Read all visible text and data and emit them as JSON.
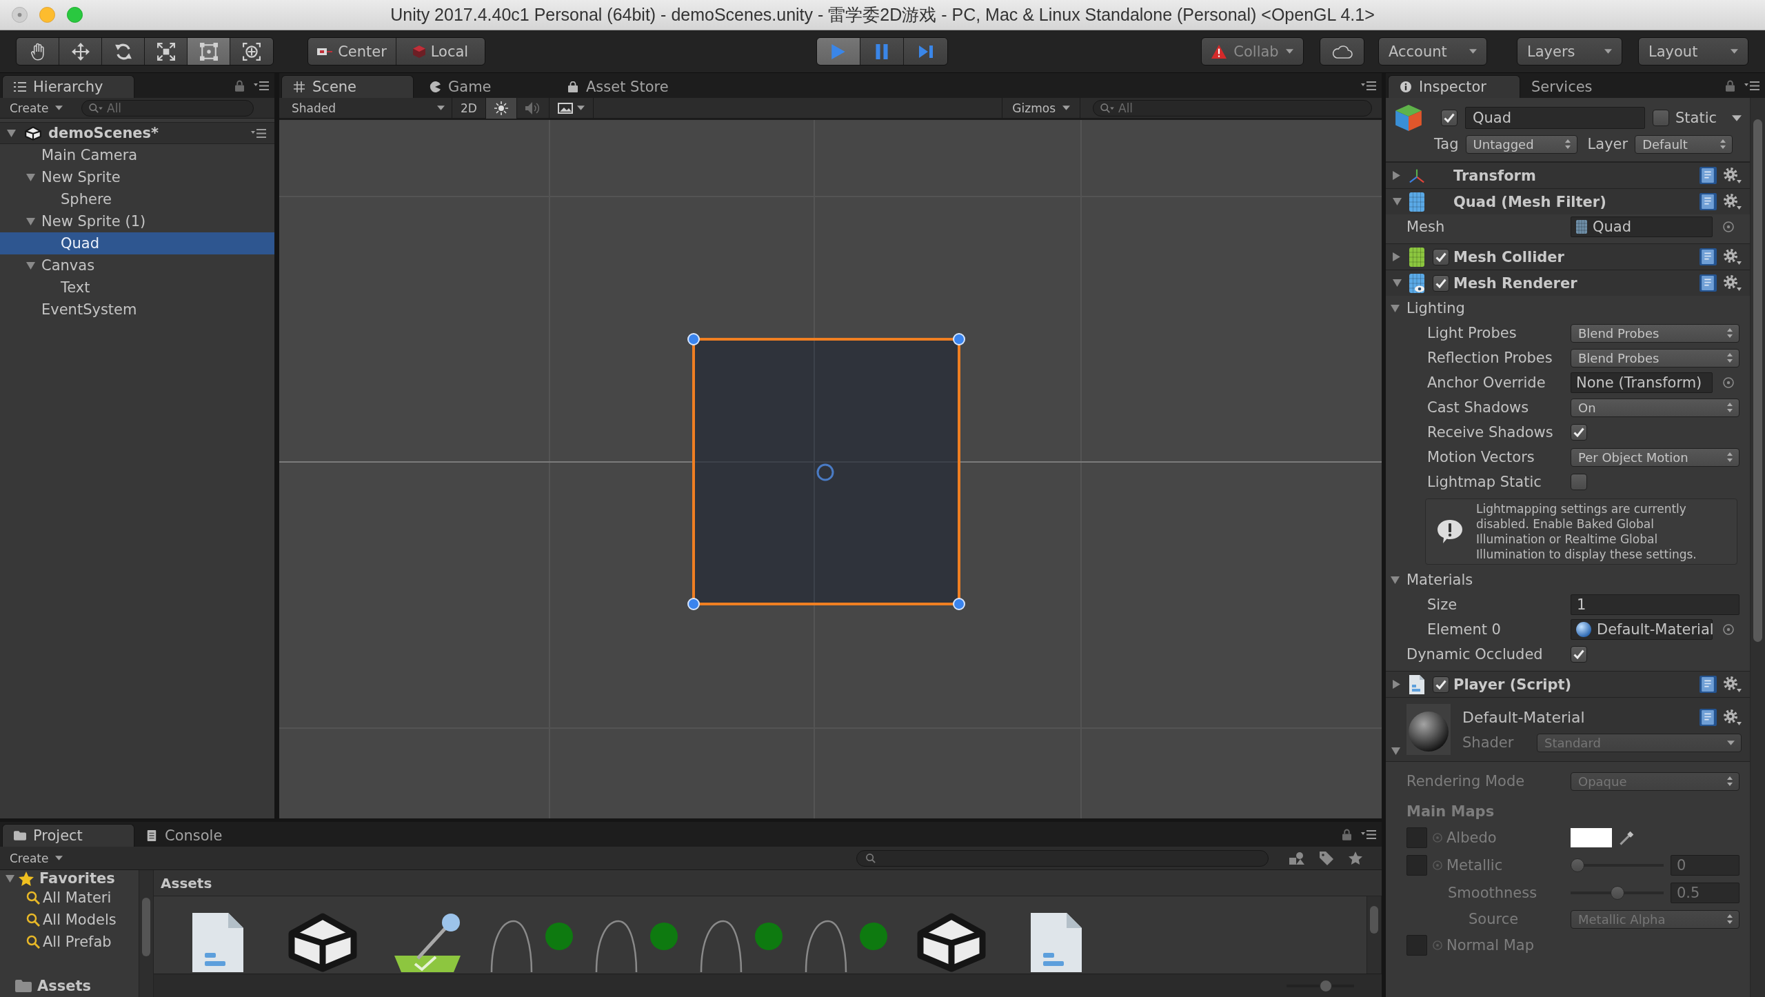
{
  "window": {
    "title": "Unity 2017.4.40c1 Personal (64bit) - demoScenes.unity - 雷学委2D游戏 - PC, Mac & Linux Standalone (Personal) <OpenGL 4.1>"
  },
  "toolbar": {
    "tools": [
      {
        "kind": "hand",
        "selected": false
      },
      {
        "kind": "move",
        "selected": false
      },
      {
        "kind": "rotate",
        "selected": false
      },
      {
        "kind": "scale",
        "selected": false
      },
      {
        "kind": "rect",
        "selected": true
      },
      {
        "kind": "transform",
        "selected": false
      }
    ],
    "pivot": [
      {
        "kind": "pivot",
        "label": "Center"
      },
      {
        "kind": "rotation",
        "label": "Local"
      }
    ],
    "playback": [
      {
        "kind": "play",
        "selected": true
      },
      {
        "kind": "pause",
        "selected": false
      },
      {
        "kind": "step",
        "selected": false
      }
    ],
    "collab": "Collab",
    "account": "Account",
    "layers": "Layers",
    "layout": "Layout"
  },
  "hierarchy": {
    "tab": "Hierarchy",
    "create": "Create",
    "search": {
      "placeholder": "All"
    },
    "root": {
      "name": "demoScenes*",
      "expanded": true,
      "children": [
        {
          "name": "Main Camera",
          "selected": false
        },
        {
          "name": "New Sprite",
          "selected": false,
          "expanded": true,
          "children": [
            {
              "name": "Sphere",
              "selected": false
            }
          ]
        },
        {
          "name": "New Sprite (1)",
          "selected": false,
          "expanded": true,
          "children": [
            {
              "name": "Quad",
              "selected": true
            }
          ]
        },
        {
          "name": "Canvas",
          "selected": false,
          "expanded": true,
          "children": [
            {
              "name": "Text",
              "selected": false
            }
          ]
        },
        {
          "name": "EventSystem",
          "selected": false
        }
      ]
    }
  },
  "scene": {
    "tabs": [
      {
        "kind": "scene",
        "label": "Scene",
        "selected": true
      },
      {
        "kind": "game",
        "label": "Game",
        "selected": false
      },
      {
        "kind": "store",
        "label": "Asset Store",
        "selected": false
      }
    ],
    "shading": "Shaded",
    "mode": "2D",
    "toggles": [
      {
        "kind": "lighting",
        "on": true
      },
      {
        "kind": "audio",
        "on": false
      }
    ],
    "gizmos": "Gizmos",
    "search": {
      "placeholder": "All"
    }
  },
  "inspector": {
    "tabs": [
      {
        "kind": "inspector",
        "label": "Inspector",
        "selected": true
      },
      {
        "kind": "services",
        "label": "Services",
        "selected": false
      }
    ],
    "object": {
      "active": true,
      "name": "Quad",
      "static": false,
      "static_label": "Static",
      "tag_label": "Tag",
      "tag": "Untagged",
      "layer_label": "Layer",
      "layer": "Default"
    },
    "components": [
      {
        "kind": "transform",
        "title": "Transform",
        "expanded": false
      },
      {
        "kind": "mesh_filter",
        "title": "Quad (Mesh Filter)",
        "expanded": true,
        "rows": [
          {
            "kind": "mesh_field",
            "label": "Mesh",
            "value": "Quad"
          }
        ]
      },
      {
        "kind": "mesh_collider",
        "title": "Mesh Collider",
        "expanded": false,
        "enabled": true
      },
      {
        "kind": "mesh_renderer",
        "title": "Mesh Renderer",
        "expanded": true,
        "enabled": true,
        "rows": [
          {
            "kind": "section",
            "label": "Lighting",
            "expanded": true,
            "children": [
              {
                "kind": "dropdown",
                "label": "Light Probes",
                "value": "Blend Probes"
              },
              {
                "kind": "dropdown",
                "label": "Reflection Probes",
                "value": "Blend Probes"
              },
              {
                "kind": "object_field",
                "label": "Anchor Override",
                "value": "None (Transform)"
              },
              {
                "kind": "dropdown",
                "label": "Cast Shadows",
                "value": "On"
              },
              {
                "kind": "checkbox",
                "label": "Receive Shadows",
                "checked": true
              },
              {
                "kind": "dropdown",
                "label": "Motion Vectors",
                "value": "Per Object Motion"
              },
              {
                "kind": "checkbox",
                "label": "Lightmap Static",
                "checked": false
              },
              {
                "kind": "help",
                "text": "Lightmapping settings are currently disabled. Enable Baked Global Illumination or Realtime Global Illumination to display these settings."
              }
            ]
          },
          {
            "kind": "section",
            "label": "Materials",
            "expanded": true,
            "children": [
              {
                "kind": "number",
                "label": "Size",
                "value": "1"
              },
              {
                "kind": "material_field",
                "label": "Element 0",
                "value": "Default-Material"
              }
            ]
          },
          {
            "kind": "checkbox",
            "label": "Dynamic Occluded",
            "checked": true
          }
        ]
      },
      {
        "kind": "script",
        "title": "Player (Script)",
        "expanded": false,
        "enabled": true
      },
      {
        "kind": "material",
        "title": "Default-Material",
        "expanded": true,
        "disabled": true,
        "shader_label": "Shader",
        "shader": "Standard",
        "rows": [
          {
            "kind": "dropdown",
            "label": "Rendering Mode",
            "value": "Opaque"
          },
          {
            "kind": "heading",
            "label": "Main Maps"
          },
          {
            "kind": "color_map",
            "label": "Albedo",
            "color": "#ffffff"
          },
          {
            "kind": "slider_map",
            "label": "Metallic",
            "level": 0,
            "reading": "0",
            "children": [
              {
                "kind": "slider",
                "label": "Smoothness",
                "level": 0.5,
                "reading": "0.5",
                "children": [
                  {
                    "kind": "dropdown",
                    "label": "Source",
                    "value": "Metallic Alpha"
                  }
                ]
              }
            ]
          },
          {
            "kind": "texture_map",
            "label": "Normal Map"
          }
        ]
      }
    ]
  },
  "project": {
    "tabs": [
      {
        "kind": "project",
        "label": "Project",
        "selected": true
      },
      {
        "kind": "console",
        "label": "Console",
        "selected": false
      }
    ],
    "create": "Create",
    "favorites": {
      "label": "Favorites",
      "expanded": true,
      "items": [
        "All Materi",
        "All Models",
        "All Prefab"
      ]
    },
    "root_folder": "Assets",
    "path": "Assets",
    "assets": [
      {
        "kind": "script"
      },
      {
        "kind": "scene"
      },
      {
        "kind": "controller"
      },
      {
        "kind": "clip"
      },
      {
        "kind": "clip"
      },
      {
        "kind": "clip"
      },
      {
        "kind": "clip"
      },
      {
        "kind": "scene"
      },
      {
        "kind": "script"
      }
    ],
    "icon_size": {
      "level": 0.6
    }
  }
}
